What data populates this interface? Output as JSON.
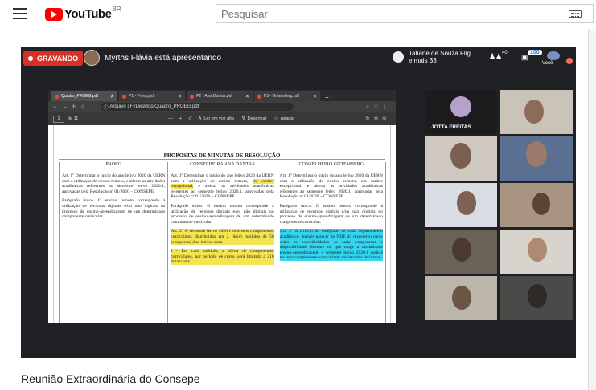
{
  "header": {
    "logo_text": "YouTube",
    "logo_region": "BR",
    "search_placeholder": "Pesquisar",
    "menu_icon": "hamburger-icon",
    "keyboard_icon": "keyboard-icon",
    "brand_color": "#ff0000"
  },
  "meet": {
    "recording_label": "GRAVANDO",
    "presenter_text": "Myrths Flávia está apresentando",
    "viewers_text_1": "Tatiane de Souza Flig...",
    "viewers_text_2": "e mais 33",
    "people_count": "40",
    "chat_count": "100",
    "you_label": "Você",
    "recording_color": "#d93025"
  },
  "browser": {
    "tabs": [
      {
        "label": "Quadro_PROEG.pdf"
      },
      {
        "label": "P1 - Proeg.pdf"
      },
      {
        "label": "P2 - Ana Dantas.pdf"
      },
      {
        "label": "P3 - Gutemberg.pdf"
      }
    ],
    "address_prefix": "Arquivo",
    "address": "F:/Desktop/Quadro_PROEG.pdf",
    "page_number": "1",
    "page_total": "de 11",
    "read_aloud": "Ler em voz alta",
    "draw": "Desenhar",
    "erase": "Apagar"
  },
  "document": {
    "title": "PROPOSTAS DE MINUTAS DE RESOLUÇÃO",
    "columns": [
      {
        "header": "PROEG",
        "p1": "Art. 1º Determinar o início do ano letivo 2020 da UERN com a utilização do ensino remoto, e alterar as atividades acadêmicas referentes ao semestre letivo 2020.1, aprovadas pela Resolução nº 01/2020 – CONSEPE.",
        "p2": "Parágrafo único. O ensino remoto corresponde à utilização de recursus digitais e/ou não digitais no processo de ensino-aprendizagem de um determinado componente curricular."
      },
      {
        "header": "CONSELHEIRA ANA DANTAS",
        "p1a": "Art. 1º Determinar o início do ano letivo 2020 da UERN com a utilização do ensino remoto,",
        "p1_highlight": "em caráter excepcional,",
        "p1b": " e alterar as atividades acadêmicas referentes ao semestre letivo 2020.1, aprovadas pela Resolução nº 01/2020 – CONSEPE.",
        "p2": "Parágrafo único. O ensino remoto corresponde à utilização de recursos digitais e/ou não digitais no processo de ensino-aprendizagem de um determinado componente curricular.",
        "p3": "Art. 2º O semestre letivo 2020.1 terá seus componentes curriculares distribuídos em 2 (dois) módulos de 50 (cinquenta) dias letivos cada.",
        "p4": "I - Em cada módulo, a oferta de componentes curriculares, por período de curso, será limitada a 210 horas/aula;"
      },
      {
        "header": "CONSELHEIRO GUTEMBERG",
        "p1": "Art. 1º Determinar o início do ano letivo 2020 da UERN com a utilização do ensino remoto, em caráter excepcional, e alterar as atividades acadêmicas referentes ao semestre letivo 2020.1, aprovadas pela Resolução nº 01/2020 – CONSEPE.",
        "p2": "Parágrafo único. O ensino remoto corresponde à utilização de recursos digitais e/ou não digitais no processo de ensino-aprendizagem de um determinado componente curricular.",
        "p3": "Art. 2º A critério do colegiado de cada departamento acadêmico, através parecer do NDE do respectivo curso sobre as especificidades de cada componente e disponibilidade docente no que tange a modalidade ensino-aprendizagem, o semestre letivo 2020.1 poderá ter seus componentes curriculares ministrados de forma"
      }
    ],
    "highlight_yellow": "#f4e44f",
    "highlight_cyan": "#33d4ee"
  },
  "participants": {
    "named_tile": "JOTTA FREITAS"
  },
  "video": {
    "title": "Reunião Extraordinária do Consepe"
  }
}
